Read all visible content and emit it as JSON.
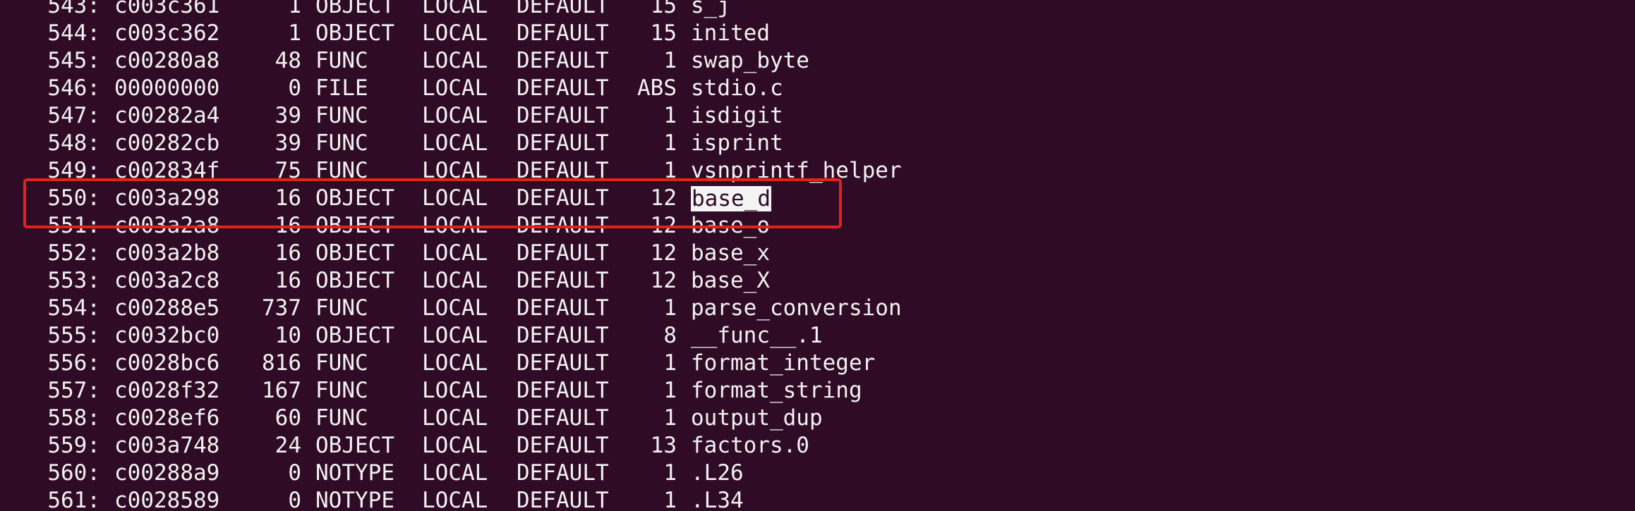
{
  "terminal": {
    "highlight_color": "#e0241c",
    "background_color": "#2f0b25",
    "text_color": "#f2f2f2",
    "highlighted_row_num": "550:",
    "rows": [
      {
        "num": "543:",
        "addr": "c003c361",
        "size": "1",
        "type": "OBJECT",
        "bind": "LOCAL",
        "vis": "DEFAULT",
        "ndx": "15",
        "name": "s_j"
      },
      {
        "num": "544:",
        "addr": "c003c362",
        "size": "1",
        "type": "OBJECT",
        "bind": "LOCAL",
        "vis": "DEFAULT",
        "ndx": "15",
        "name": "inited"
      },
      {
        "num": "545:",
        "addr": "c00280a8",
        "size": "48",
        "type": "FUNC",
        "bind": "LOCAL",
        "vis": "DEFAULT",
        "ndx": "1",
        "name": "swap_byte"
      },
      {
        "num": "546:",
        "addr": "00000000",
        "size": "0",
        "type": "FILE",
        "bind": "LOCAL",
        "vis": "DEFAULT",
        "ndx": "ABS",
        "name": "stdio.c"
      },
      {
        "num": "547:",
        "addr": "c00282a4",
        "size": "39",
        "type": "FUNC",
        "bind": "LOCAL",
        "vis": "DEFAULT",
        "ndx": "1",
        "name": "isdigit"
      },
      {
        "num": "548:",
        "addr": "c00282cb",
        "size": "39",
        "type": "FUNC",
        "bind": "LOCAL",
        "vis": "DEFAULT",
        "ndx": "1",
        "name": "isprint"
      },
      {
        "num": "549:",
        "addr": "c002834f",
        "size": "75",
        "type": "FUNC",
        "bind": "LOCAL",
        "vis": "DEFAULT",
        "ndx": "1",
        "name": "vsnprintf_helper"
      },
      {
        "num": "550:",
        "addr": "c003a298",
        "size": "16",
        "type": "OBJECT",
        "bind": "LOCAL",
        "vis": "DEFAULT",
        "ndx": "12",
        "name": "base_d",
        "selected": true
      },
      {
        "num": "551:",
        "addr": "c003a2a8",
        "size": "16",
        "type": "OBJECT",
        "bind": "LOCAL",
        "vis": "DEFAULT",
        "ndx": "12",
        "name": "base_o"
      },
      {
        "num": "552:",
        "addr": "c003a2b8",
        "size": "16",
        "type": "OBJECT",
        "bind": "LOCAL",
        "vis": "DEFAULT",
        "ndx": "12",
        "name": "base_x"
      },
      {
        "num": "553:",
        "addr": "c003a2c8",
        "size": "16",
        "type": "OBJECT",
        "bind": "LOCAL",
        "vis": "DEFAULT",
        "ndx": "12",
        "name": "base_X"
      },
      {
        "num": "554:",
        "addr": "c00288e5",
        "size": "737",
        "type": "FUNC",
        "bind": "LOCAL",
        "vis": "DEFAULT",
        "ndx": "1",
        "name": "parse_conversion"
      },
      {
        "num": "555:",
        "addr": "c0032bc0",
        "size": "10",
        "type": "OBJECT",
        "bind": "LOCAL",
        "vis": "DEFAULT",
        "ndx": "8",
        "name": "__func__.1"
      },
      {
        "num": "556:",
        "addr": "c0028bc6",
        "size": "816",
        "type": "FUNC",
        "bind": "LOCAL",
        "vis": "DEFAULT",
        "ndx": "1",
        "name": "format_integer"
      },
      {
        "num": "557:",
        "addr": "c0028f32",
        "size": "167",
        "type": "FUNC",
        "bind": "LOCAL",
        "vis": "DEFAULT",
        "ndx": "1",
        "name": "format_string"
      },
      {
        "num": "558:",
        "addr": "c0028ef6",
        "size": "60",
        "type": "FUNC",
        "bind": "LOCAL",
        "vis": "DEFAULT",
        "ndx": "1",
        "name": "output_dup"
      },
      {
        "num": "559:",
        "addr": "c003a748",
        "size": "24",
        "type": "OBJECT",
        "bind": "LOCAL",
        "vis": "DEFAULT",
        "ndx": "13",
        "name": "factors.0"
      },
      {
        "num": "560:",
        "addr": "c00288a9",
        "size": "0",
        "type": "NOTYPE",
        "bind": "LOCAL",
        "vis": "DEFAULT",
        "ndx": "1",
        "name": ".L26"
      },
      {
        "num": "561:",
        "addr": "c0028589",
        "size": "0",
        "type": "NOTYPE",
        "bind": "LOCAL",
        "vis": "DEFAULT",
        "ndx": "1",
        "name": ".L34"
      }
    ]
  }
}
